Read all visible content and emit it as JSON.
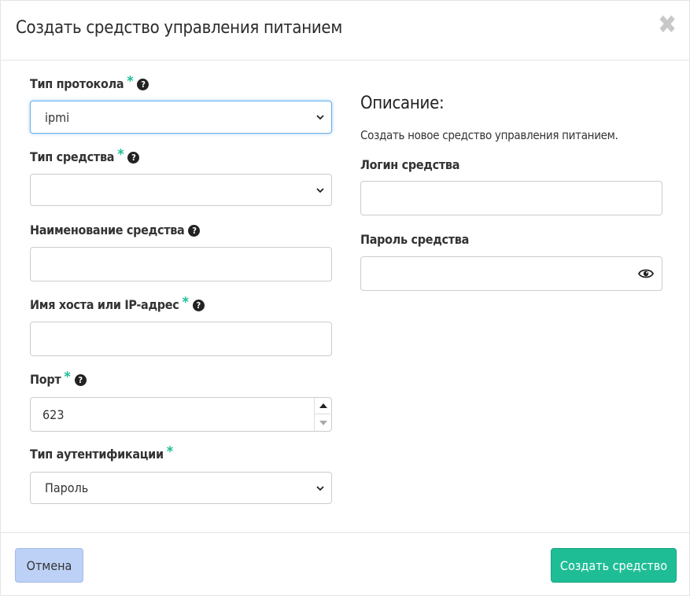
{
  "modal": {
    "title": "Создать средство управления питанием",
    "close_symbol": "✖"
  },
  "form": {
    "protocol": {
      "label": "Тип протокола",
      "required_mark": "*",
      "value": "ipmi"
    },
    "driver_type": {
      "label": "Тип средства",
      "required_mark": "*",
      "value": ""
    },
    "driver_name": {
      "label": "Наименование средства",
      "value": ""
    },
    "host": {
      "label": "Имя хоста или IP-адрес",
      "required_mark": "*",
      "value": ""
    },
    "port": {
      "label": "Порт",
      "required_mark": "*",
      "value": "623"
    },
    "auth_type": {
      "label": "Тип аутентификации",
      "required_mark": "*",
      "value": "Пароль"
    }
  },
  "description": {
    "title": "Описание:",
    "text": "Создать новое средство управления питанием."
  },
  "credentials": {
    "login": {
      "label": "Логин средства",
      "value": ""
    },
    "password": {
      "label": "Пароль средства",
      "value": ""
    }
  },
  "footer": {
    "cancel_label": "Отмена",
    "create_label": "Создать средство"
  },
  "colors": {
    "accent": "#1fbd96",
    "cancel_bg": "#bcd1f5",
    "focus_border": "#66afe9"
  },
  "icons": {
    "help": "question-circle-icon",
    "eye": "eye-icon",
    "close": "close-icon",
    "chevron": "chevron-down-icon"
  }
}
